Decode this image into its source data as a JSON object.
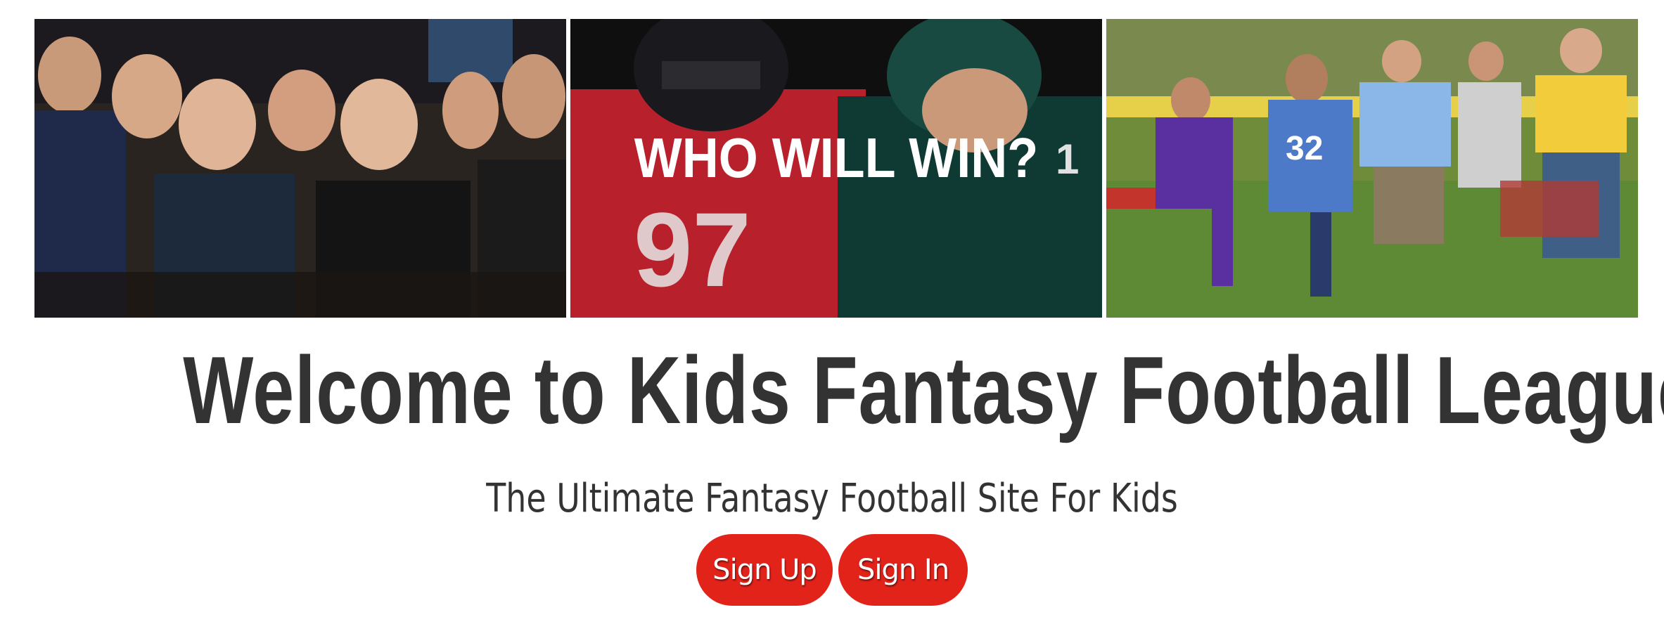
{
  "banner": {
    "panels": [
      {
        "name": "kids-crowd-photo"
      },
      {
        "name": "players-matchup-photo",
        "overlay_text": "WHO WILL WIN?"
      },
      {
        "name": "kids-playing-field-photo"
      }
    ]
  },
  "hero": {
    "title": "Welcome to Kids Fantasy Football League",
    "subtitle": "The Ultimate Fantasy Football Site For Kids"
  },
  "actions": {
    "sign_up_label": "Sign Up",
    "sign_in_label": "Sign In"
  },
  "colors": {
    "accent": "#e2231a",
    "text": "#333333",
    "background": "#ffffff"
  }
}
